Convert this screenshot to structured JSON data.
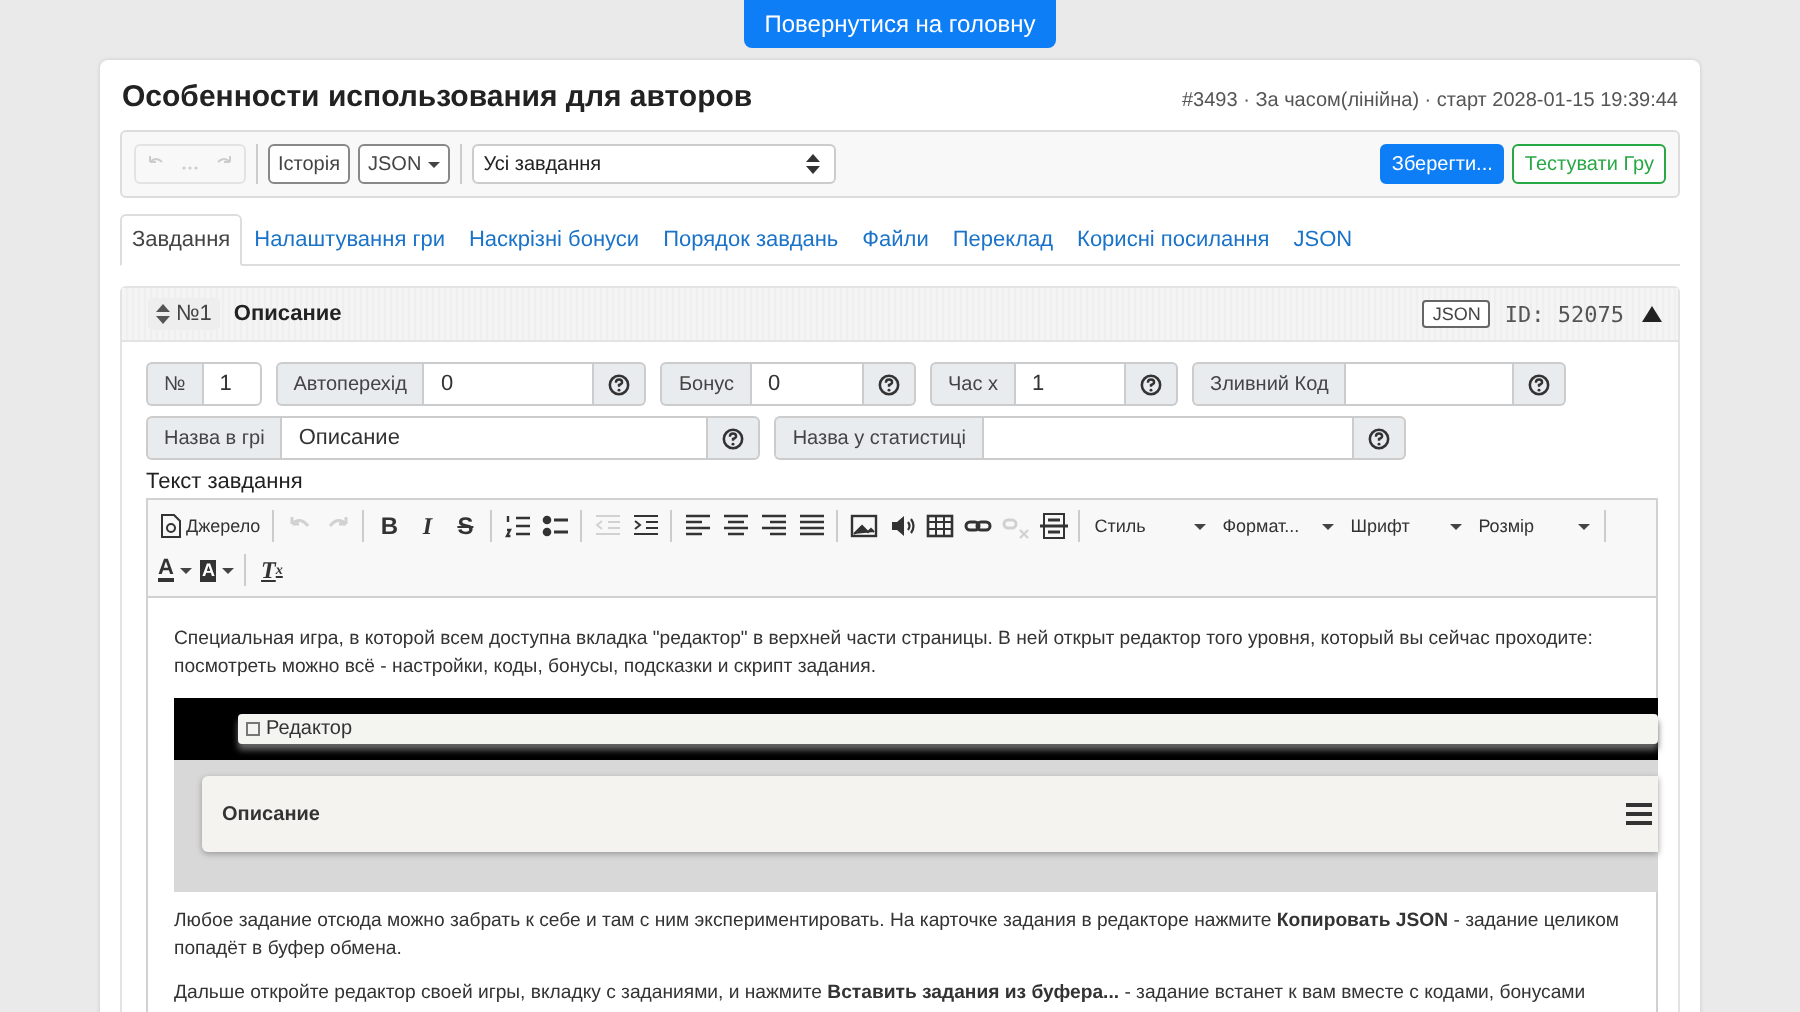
{
  "top_button": "Повернутися на головну",
  "header": {
    "title": "Особенности использования для авторов",
    "meta": "#3493 · За часом(лінійна) · старт 2028-01-15 19:39:44"
  },
  "toolbar": {
    "history_disabled": true,
    "history_button": "Історія",
    "json_button": "JSON",
    "task_select": "Усі завдання",
    "save_button": "Зберегти...",
    "test_button": "Тестувати Гру"
  },
  "tabs": [
    {
      "label": "Завдання",
      "selected": true
    },
    {
      "label": "Налаштування гри",
      "selected": false
    },
    {
      "label": "Наскрізні бонуси",
      "selected": false
    },
    {
      "label": "Порядок завдань",
      "selected": false
    },
    {
      "label": "Файли",
      "selected": false
    },
    {
      "label": "Переклад",
      "selected": false
    },
    {
      "label": "Корисні посилання",
      "selected": false
    },
    {
      "label": "JSON",
      "selected": false
    }
  ],
  "task": {
    "number": "№1",
    "name": "Описание",
    "json_button": "JSON",
    "id": "ID: 52075",
    "expanded": true,
    "field_groups": [
      {
        "fields": [
          {
            "label": "№",
            "value": "1",
            "kind": "plain"
          },
          {
            "label": "Автоперехід",
            "value": "0",
            "kind": "help"
          },
          {
            "label": "Бонус",
            "value": "0",
            "kind": "help"
          },
          {
            "label": "Час x",
            "value": "1",
            "kind": "help"
          },
          {
            "label": "Зливний Код",
            "kind": "help"
          }
        ]
      },
      {
        "fields": [
          {
            "label": "Назва в грі",
            "value": "Описание",
            "kind": "help"
          },
          {
            "label": "Назва у статистиці",
            "kind": "help"
          }
        ]
      }
    ],
    "text_label": "Текст завдання"
  },
  "editor": {
    "buttons": [
      {
        "kind": "source",
        "label": "Джерело"
      },
      {
        "kind": "sep"
      },
      {
        "kind": "icon",
        "disabled": true
      },
      {
        "kind": "icon",
        "disabled": true
      },
      {
        "kind": "sep"
      },
      {
        "kind": "glyph",
        "label": "B",
        "disabled": false
      },
      {
        "kind": "glyph",
        "label": "I",
        "disabled": false
      },
      {
        "kind": "glyph",
        "label": "S",
        "disabled": false
      },
      {
        "kind": "sep"
      },
      {
        "kind": "icon",
        "disabled": false
      },
      {
        "kind": "icon",
        "disabled": false
      },
      {
        "kind": "sep"
      },
      {
        "kind": "icon",
        "disabled": true
      },
      {
        "kind": "icon",
        "disabled": false
      },
      {
        "kind": "sep"
      },
      {
        "kind": "icon",
        "disabled": false
      },
      {
        "kind": "icon",
        "disabled": false
      },
      {
        "kind": "icon",
        "disabled": false
      },
      {
        "kind": "icon",
        "disabled": false
      },
      {
        "kind": "sep"
      },
      {
        "kind": "icon",
        "disabled": false
      },
      {
        "kind": "icon",
        "disabled": false
      },
      {
        "kind": "icon",
        "disabled": false
      },
      {
        "kind": "icon",
        "disabled": false
      },
      {
        "kind": "icon",
        "disabled": true
      },
      {
        "kind": "icon",
        "disabled": false
      },
      {
        "kind": "sep"
      },
      {
        "kind": "combo",
        "label": "Стиль"
      },
      {
        "kind": "combo",
        "label": "Формат..."
      },
      {
        "kind": "combo",
        "label": "Шрифт"
      },
      {
        "kind": "combo",
        "label": "Розмір"
      },
      {
        "kind": "sep"
      },
      {
        "kind": "color",
        "label": "A"
      },
      {
        "kind": "bgcolor",
        "label": "A"
      },
      {
        "kind": "sep"
      },
      {
        "kind": "clear",
        "label": "T",
        "sub": "x"
      }
    ],
    "paragraphs_before": [
      "Специальная игра, в которой всем доступна вкладка \"редактор\" в верхней части страницы. В ней открыт редактор того уровня, который вы сейчас проходите: посмотреть можно всё - настройки, коды, бонусы, подсказки и скрипт задания."
    ],
    "shot": {
      "menu": "Редактор",
      "card": "Описание"
    },
    "paragraphs_after": [
      "Любое задание отсюда можно забрать к себе и там с ним экспериментировать. На карточке задания в редакторе нажмите **Копировать JSON** - задание целиком попадёт в буфер обмена.",
      "Дальше откройте редактор своей игры, вкладку с заданиями, и нажмите **Вставить задания из буфера...** - задание встанет к вам вместе с кодами, бонусами"
    ]
  }
}
